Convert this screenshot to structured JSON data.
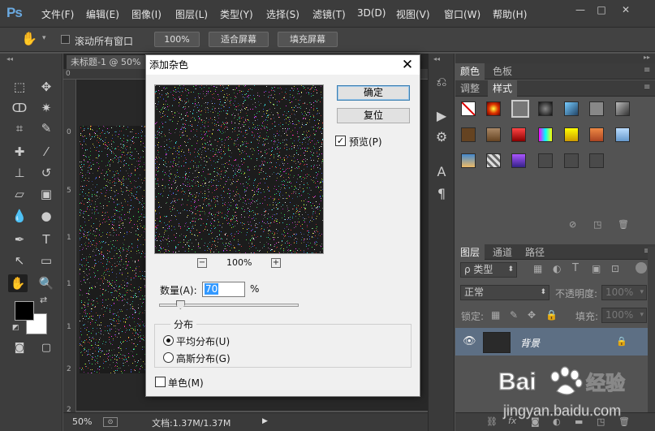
{
  "menubar": {
    "logo": "Ps",
    "items": [
      "文件(F)",
      "编辑(E)",
      "图像(I)",
      "图层(L)",
      "类型(Y)",
      "选择(S)",
      "滤镜(T)",
      "3D(D)",
      "视图(V)",
      "窗口(W)",
      "帮助(H)"
    ],
    "win_controls": [
      "—",
      "□",
      "✕"
    ]
  },
  "options": {
    "scroll_all_label": "滚动所有窗口",
    "btn_100": "100%",
    "btn_fit": "适合屏幕",
    "btn_fill": "填充屏幕"
  },
  "document": {
    "tab_title": "未标题-1 @ 50%",
    "ruler_top": [
      "0"
    ],
    "ruler_left": [
      "0",
      "5",
      "1",
      "1",
      "1",
      "2",
      "2"
    ],
    "zoom": "50%",
    "doc_info": "文档:1.37M/1.37M"
  },
  "dialog": {
    "title": "添加杂色",
    "ok": "确定",
    "reset": "复位",
    "preview_label": "预览(P)",
    "preview_checked": true,
    "zoom_minus": "−",
    "zoom_plus": "+",
    "zoom_level": "100%",
    "amount_label": "数量(A):",
    "amount_value": "70",
    "amount_unit": "%",
    "amount_slider_percent": 15,
    "distribution_legend": "分布",
    "uniform_label": "平均分布(U)",
    "gaussian_label": "高斯分布(G)",
    "uniform_selected": true,
    "mono_label": "单色(M)",
    "mono_checked": false
  },
  "panels": {
    "tabs_top": [
      "颜色",
      "色板"
    ],
    "tabs_second": [
      "调整",
      "样式"
    ],
    "tabs_layers": [
      "图层",
      "通道",
      "路径"
    ],
    "filter_kind": "ρ 类型",
    "blend_mode": "正常",
    "opacity_label": "不透明度:",
    "opacity_value": "100%",
    "lock_label": "锁定:",
    "fill_label": "填充:",
    "fill_value": "100%",
    "layer_name": "背景"
  },
  "watermark": {
    "brand": "Bai",
    "brand_suffix": "经验",
    "url": "jingyan.baidu.com"
  },
  "colors": {
    "accent": "#3399ff",
    "selected_layer": "#5d6f84"
  }
}
